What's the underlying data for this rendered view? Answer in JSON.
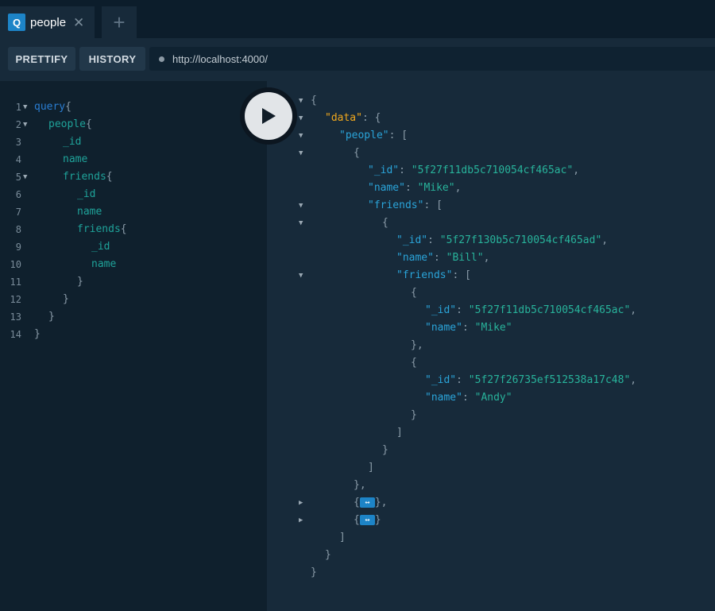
{
  "tab": {
    "badge": "Q",
    "title": "people",
    "close": "✕",
    "add": "+"
  },
  "toolbar": {
    "prettify": "PRETTIFY",
    "history": "HISTORY",
    "url": "http://localhost:4000/"
  },
  "editor": {
    "lines": [
      {
        "n": "1",
        "fold": true,
        "tokens": [
          [
            "kw",
            "query"
          ],
          [
            "pn",
            "{"
          ]
        ],
        "indent": 0
      },
      {
        "n": "2",
        "fold": true,
        "tokens": [
          [
            "fld",
            "people"
          ],
          [
            "pn",
            "{"
          ]
        ],
        "indent": 1
      },
      {
        "n": "3",
        "fold": false,
        "tokens": [
          [
            "fld",
            "_id"
          ]
        ],
        "indent": 2
      },
      {
        "n": "4",
        "fold": false,
        "tokens": [
          [
            "fld",
            "name"
          ]
        ],
        "indent": 2
      },
      {
        "n": "5",
        "fold": true,
        "tokens": [
          [
            "fld",
            "friends"
          ],
          [
            "pn",
            "{"
          ]
        ],
        "indent": 2
      },
      {
        "n": "6",
        "fold": false,
        "tokens": [
          [
            "fld",
            "_id"
          ]
        ],
        "indent": 3
      },
      {
        "n": "7",
        "fold": false,
        "tokens": [
          [
            "fld",
            "name"
          ]
        ],
        "indent": 3
      },
      {
        "n": "8",
        "fold": false,
        "tokens": [
          [
            "fld",
            "friends"
          ],
          [
            "pn",
            "{"
          ]
        ],
        "indent": 3
      },
      {
        "n": "9",
        "fold": false,
        "tokens": [
          [
            "fld",
            "_id"
          ]
        ],
        "indent": 4
      },
      {
        "n": "10",
        "fold": false,
        "tokens": [
          [
            "fld",
            "name"
          ]
        ],
        "indent": 4
      },
      {
        "n": "11",
        "fold": false,
        "tokens": [
          [
            "pn",
            "}"
          ]
        ],
        "indent": 3
      },
      {
        "n": "12",
        "fold": false,
        "tokens": [
          [
            "pn",
            "}"
          ]
        ],
        "indent": 2
      },
      {
        "n": "13",
        "fold": false,
        "tokens": [
          [
            "pn",
            "}"
          ]
        ],
        "indent": 1
      },
      {
        "n": "14",
        "fold": false,
        "tokens": [
          [
            "pn",
            "}"
          ]
        ],
        "indent": 0
      }
    ]
  },
  "result": {
    "lines": [
      {
        "fold": "down",
        "indent": 0,
        "tokens": [
          [
            "pn",
            "{"
          ]
        ]
      },
      {
        "fold": "down",
        "indent": 1,
        "tokens": [
          [
            "dkey",
            "\"data\""
          ],
          [
            "pn",
            ": {"
          ]
        ]
      },
      {
        "fold": "down",
        "indent": 2,
        "tokens": [
          [
            "key",
            "\"people\""
          ],
          [
            "pn",
            ": ["
          ]
        ]
      },
      {
        "fold": "down",
        "indent": 3,
        "tokens": [
          [
            "pn",
            "{"
          ]
        ]
      },
      {
        "fold": "",
        "indent": 4,
        "tokens": [
          [
            "key",
            "\"_id\""
          ],
          [
            "pn",
            ": "
          ],
          [
            "str",
            "\"5f27f11db5c710054cf465ac\""
          ],
          [
            "pn",
            ","
          ]
        ]
      },
      {
        "fold": "",
        "indent": 4,
        "tokens": [
          [
            "key",
            "\"name\""
          ],
          [
            "pn",
            ": "
          ],
          [
            "str",
            "\"Mike\""
          ],
          [
            "pn",
            ","
          ]
        ]
      },
      {
        "fold": "down",
        "indent": 4,
        "tokens": [
          [
            "key",
            "\"friends\""
          ],
          [
            "pn",
            ": ["
          ]
        ]
      },
      {
        "fold": "down",
        "indent": 5,
        "tokens": [
          [
            "pn",
            "{"
          ]
        ]
      },
      {
        "fold": "",
        "indent": 6,
        "tokens": [
          [
            "key",
            "\"_id\""
          ],
          [
            "pn",
            ": "
          ],
          [
            "str",
            "\"5f27f130b5c710054cf465ad\""
          ],
          [
            "pn",
            ","
          ]
        ]
      },
      {
        "fold": "",
        "indent": 6,
        "tokens": [
          [
            "key",
            "\"name\""
          ],
          [
            "pn",
            ": "
          ],
          [
            "str",
            "\"Bill\""
          ],
          [
            "pn",
            ","
          ]
        ]
      },
      {
        "fold": "down",
        "indent": 6,
        "tokens": [
          [
            "key",
            "\"friends\""
          ],
          [
            "pn",
            ": ["
          ]
        ]
      },
      {
        "fold": "",
        "indent": 7,
        "tokens": [
          [
            "pn",
            "{"
          ]
        ]
      },
      {
        "fold": "",
        "indent": 8,
        "tokens": [
          [
            "key",
            "\"_id\""
          ],
          [
            "pn",
            ": "
          ],
          [
            "str",
            "\"5f27f11db5c710054cf465ac\""
          ],
          [
            "pn",
            ","
          ]
        ]
      },
      {
        "fold": "",
        "indent": 8,
        "tokens": [
          [
            "key",
            "\"name\""
          ],
          [
            "pn",
            ": "
          ],
          [
            "str",
            "\"Mike\""
          ]
        ]
      },
      {
        "fold": "",
        "indent": 7,
        "tokens": [
          [
            "pn",
            "},"
          ]
        ]
      },
      {
        "fold": "",
        "indent": 7,
        "tokens": [
          [
            "pn",
            "{"
          ]
        ]
      },
      {
        "fold": "",
        "indent": 8,
        "tokens": [
          [
            "key",
            "\"_id\""
          ],
          [
            "pn",
            ": "
          ],
          [
            "str",
            "\"5f27f26735ef512538a17c48\""
          ],
          [
            "pn",
            ","
          ]
        ]
      },
      {
        "fold": "",
        "indent": 8,
        "tokens": [
          [
            "key",
            "\"name\""
          ],
          [
            "pn",
            ": "
          ],
          [
            "str",
            "\"Andy\""
          ]
        ]
      },
      {
        "fold": "",
        "indent": 7,
        "tokens": [
          [
            "pn",
            "}"
          ]
        ]
      },
      {
        "fold": "",
        "indent": 6,
        "tokens": [
          [
            "pn",
            "]"
          ]
        ]
      },
      {
        "fold": "",
        "indent": 5,
        "tokens": [
          [
            "pn",
            "}"
          ]
        ]
      },
      {
        "fold": "",
        "indent": 4,
        "tokens": [
          [
            "pn",
            "]"
          ]
        ]
      },
      {
        "fold": "",
        "indent": 3,
        "tokens": [
          [
            "pn",
            "},"
          ]
        ]
      },
      {
        "fold": "right",
        "indent": 3,
        "tokens": [
          [
            "pn",
            "{"
          ],
          [
            "pill",
            "↔"
          ],
          [
            "pn",
            "},"
          ]
        ]
      },
      {
        "fold": "right",
        "indent": 3,
        "tokens": [
          [
            "pn",
            "{"
          ],
          [
            "pill",
            "↔"
          ],
          [
            "pn",
            "}"
          ]
        ]
      },
      {
        "fold": "",
        "indent": 2,
        "tokens": [
          [
            "pn",
            "]"
          ]
        ]
      },
      {
        "fold": "",
        "indent": 1,
        "tokens": [
          [
            "pn",
            "}"
          ]
        ]
      },
      {
        "fold": "",
        "indent": 0,
        "tokens": [
          [
            "pn",
            "}"
          ]
        ]
      }
    ]
  },
  "colors": {
    "background": "#172a3a",
    "editor": "#0f202d",
    "accent": "#1d84c7",
    "json_key": "#2aa4d9",
    "json_string": "#28b39b",
    "data_key": "#f1a81d"
  }
}
